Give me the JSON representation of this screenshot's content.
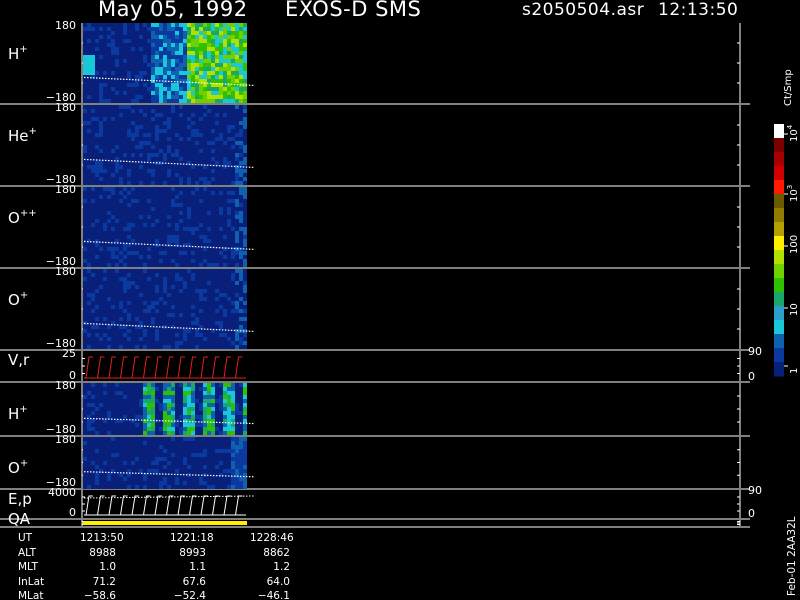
{
  "header": {
    "date": "May 05, 1992",
    "instrument": "EXOS-D SMS",
    "filename": "s2050504.asr",
    "time": "12:13:50"
  },
  "panels": [
    {
      "key": "h1",
      "label_base": "H",
      "label_sup": "+",
      "tick_top": "180",
      "tick_bottom": "−180"
    },
    {
      "key": "he1",
      "label_base": "He",
      "label_sup": "+",
      "tick_top": "180",
      "tick_bottom": "−180"
    },
    {
      "key": "opp",
      "label_base": "O",
      "label_sup": "++",
      "tick_top": "180",
      "tick_bottom": "−180"
    },
    {
      "key": "o1",
      "label_base": "O",
      "label_sup": "+",
      "tick_top": "180",
      "tick_bottom": "−180"
    },
    {
      "key": "vr",
      "label_base": "V,r",
      "label_sup": "",
      "tick_top": "25",
      "tick_bottom": "0",
      "right_top": "90",
      "right_bottom": "0"
    },
    {
      "key": "h2",
      "label_base": "H",
      "label_sup": "+",
      "tick_top": "180",
      "tick_bottom": "−180"
    },
    {
      "key": "o2",
      "label_base": "O",
      "label_sup": "+",
      "tick_top": "180",
      "tick_bottom": "−180"
    },
    {
      "key": "ep",
      "label_base": "E,p",
      "label_sup": "",
      "tick_top": "4000",
      "tick_bottom": "0",
      "right_top": "90",
      "right_bottom": "0"
    },
    {
      "key": "qa",
      "label_base": "QA",
      "label_sup": ""
    }
  ],
  "colorbar": {
    "title": "Ct/Smp",
    "ticks": [
      {
        "base": "10",
        "sup": "4"
      },
      {
        "base": "10",
        "sup": "3"
      },
      {
        "base": "100",
        "sup": ""
      },
      {
        "base": "10",
        "sup": ""
      },
      {
        "base": "1",
        "sup": ""
      }
    ],
    "colors": [
      "#ffffff",
      "#7a0000",
      "#a80000",
      "#d00000",
      "#ff1a00",
      "#6b5a00",
      "#8f7c00",
      "#b3a100",
      "#ffee00",
      "#b4e000",
      "#6fd000",
      "#2fc000",
      "#18a86a",
      "#2aa0c8",
      "#18c8d8",
      "#1060b0",
      "#0a3aa0",
      "#08207a"
    ]
  },
  "footer": {
    "rows": [
      {
        "label": "UT",
        "values": [
          "1213:50",
          "1221:18",
          "1228:46"
        ]
      },
      {
        "label": "ALT",
        "values": [
          "8988",
          "8993",
          "8862"
        ]
      },
      {
        "label": "MLT",
        "values": [
          "1.0",
          "1.1",
          "1.2"
        ]
      },
      {
        "label": "InLat",
        "values": [
          "71.2",
          "67.6",
          "64.0"
        ]
      },
      {
        "label": "MLat",
        "values": [
          "−58.6",
          "−52.4",
          "−46.1"
        ]
      }
    ]
  },
  "file_id": "Feb-01 2AA32L",
  "chart_data": {
    "type": "heatmap",
    "title": "May 05, 1992   EXOS-D SMS",
    "x": {
      "label": "UT",
      "ticks": [
        "1213:50",
        "1221:18",
        "1228:46"
      ]
    },
    "y_ranges": {
      "pitch_panels": [
        -180,
        180
      ],
      "V,r": [
        0,
        25
      ],
      "E,p": [
        0,
        4000
      ],
      "right_axis_V,r": [
        0,
        90
      ],
      "right_axis_E,p": [
        0,
        90
      ]
    },
    "series": [
      {
        "name": "H+"
      },
      {
        "name": "He+"
      },
      {
        "name": "O++"
      },
      {
        "name": "O+"
      },
      {
        "name": "V,r"
      },
      {
        "name": "H+"
      },
      {
        "name": "O+"
      },
      {
        "name": "E,p"
      },
      {
        "name": "QA"
      }
    ],
    "colorbar": {
      "label": "Ct/Smp",
      "scale": "log",
      "range": [
        1,
        10000
      ]
    }
  }
}
